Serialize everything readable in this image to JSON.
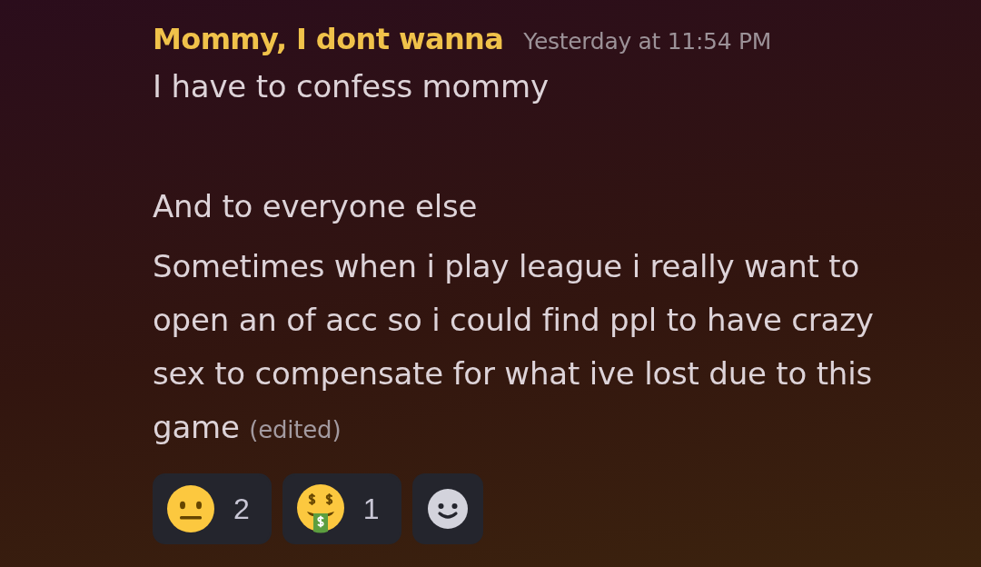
{
  "message_group": {
    "author": "Mommy, I dont wanna",
    "timestamp": "Yesterday at 11:54 PM",
    "messages": [
      {
        "text": "I have to confess mommy",
        "edited": false
      },
      {
        "text": "And to everyone else",
        "edited": false
      },
      {
        "text": "Sometimes when i play league i really want to open an of acc so i could find ppl to have crazy sex to compensate for what ive lost due to this game",
        "edited": true,
        "edited_label": "(edited)"
      }
    ],
    "reactions": [
      {
        "kind": "neutral-face",
        "count": "2",
        "selected": false
      },
      {
        "kind": "money-mouth-face",
        "count": "1",
        "selected": false
      }
    ]
  }
}
